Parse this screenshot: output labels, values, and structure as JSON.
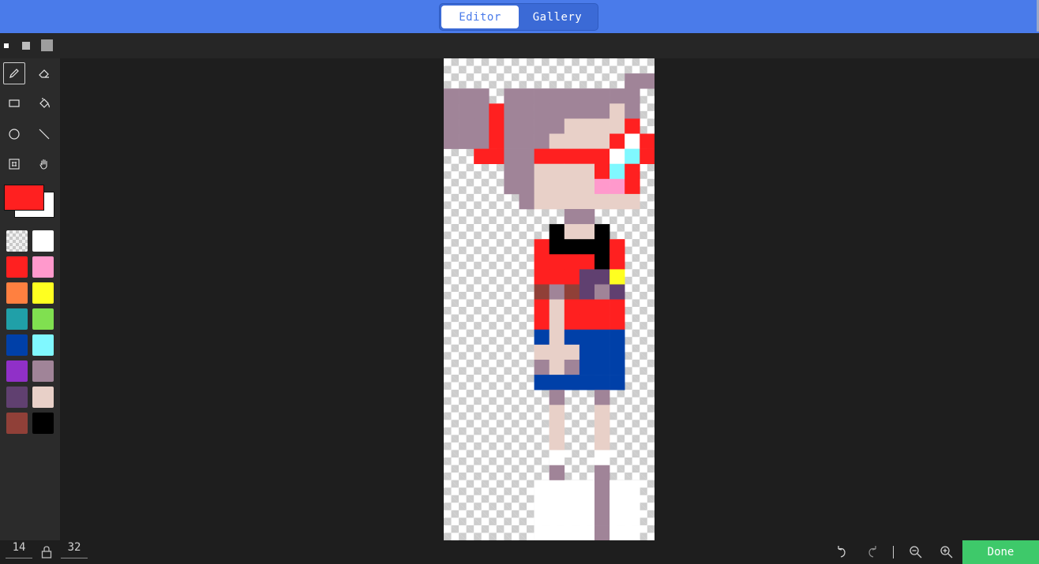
{
  "header": {
    "tabs": [
      {
        "label": "Editor",
        "active": true
      },
      {
        "label": "Gallery",
        "active": false
      }
    ]
  },
  "brush_sizes": [
    "small",
    "medium",
    "large"
  ],
  "tools": [
    {
      "name": "pencil",
      "icon": "pencil-icon",
      "active": true
    },
    {
      "name": "eraser",
      "icon": "eraser-icon",
      "active": false
    },
    {
      "name": "rectangle",
      "icon": "rectangle-icon",
      "active": false
    },
    {
      "name": "fill",
      "icon": "paint-bucket-icon",
      "active": false
    },
    {
      "name": "circle",
      "icon": "circle-icon",
      "active": false
    },
    {
      "name": "line",
      "icon": "line-icon",
      "active": false
    },
    {
      "name": "marquee",
      "icon": "marquee-icon",
      "active": false
    },
    {
      "name": "pan",
      "icon": "hand-icon",
      "active": false
    }
  ],
  "colors": {
    "foreground": "#ff2020",
    "background": "#ffffff",
    "accent": "#4a7bea",
    "done": "#3ec96a"
  },
  "palette": [
    "transparent",
    "#ffffff",
    "#ff2020",
    "#ff99cc",
    "#ff8040",
    "#ffff20",
    "#20a0a8",
    "#80e050",
    "#0040a8",
    "#80f8ff",
    "#9030c8",
    "#a08498",
    "#604070",
    "#e8d0c8",
    "#904038",
    "#000000"
  ],
  "sprite": {
    "colors": {
      "H": "#a08498",
      "R": "#ff2020",
      "S": "#e8d0c8",
      "W": "#ffffff",
      "C": "#80f8ff",
      "P": "#ff99cc",
      "K": "#000000",
      "Y": "#ffff20",
      "D": "#604070",
      "B": "#904038",
      "N": "#0040a8"
    },
    "rows": [
      "..........",
      "............HH..",
      "HHH.HHHHHHHHH.",
      "HHHRHHHHHHHSH.",
      "HHHRHHHHSSSSR.",
      "HHHRHHHSSSSRWR",
      "..RRHHRRRRRWCR",
      "....HHSSSSRCR",
      "....HHSSSSPPR.",
      ".....HSSSSSSS.",
      "........HH....",
      ".......KSSK...",
      "......RKKKKR..",
      "......RRRRKR..",
      "......RRRDDY..",
      "......BHBDHD..",
      "......RSRRRR..",
      "......RSRRRR..",
      "......NSNNNN..",
      "......SSSNNN..",
      "......HSHNNN..",
      "......NNNNNN..",
      ".......H..H...",
      ".......S..S...",
      ".......S..S...",
      ".......S..S...",
      ".......W..W...",
      ".......H..H...",
      "......WWWWHWW.",
      "......WWWWHWW.",
      "......WWWWHWW.",
      "......WWWWHWW."
    ]
  },
  "dimensions": {
    "width": "14",
    "height": "32"
  },
  "footer": {
    "done_label": "Done"
  }
}
